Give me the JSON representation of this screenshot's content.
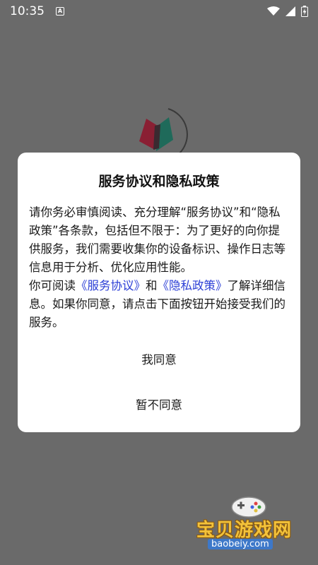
{
  "status_bar": {
    "time": "10:35",
    "notification_letter": "A"
  },
  "dialog": {
    "title": "服务协议和隐私政策",
    "body_para1": "请你务必审慎阅读、充分理解“服务协议”和“隐私政策”各条款，包括但不限于：为了更好的向你提供服务，我们需要收集你的设备标识、操作日志等信息用于分析、优化应用性能。",
    "body_para2_prefix": "你可阅读",
    "link_service": "《服务协议》",
    "link_and": "和",
    "link_privacy": "《隐私政策》",
    "body_para2_suffix": "了解详细信息。如果你同意，请点击下面按钮开始接受我们的服务。",
    "agree_button": "我同意",
    "disagree_button": "暂不同意"
  },
  "watermark": {
    "name": "宝贝游戏网",
    "url": "baobeiy.com"
  },
  "colors": {
    "overlay": "#6a6a6a",
    "link": "#2c3fd6",
    "dialog_bg": "#ffffff"
  }
}
